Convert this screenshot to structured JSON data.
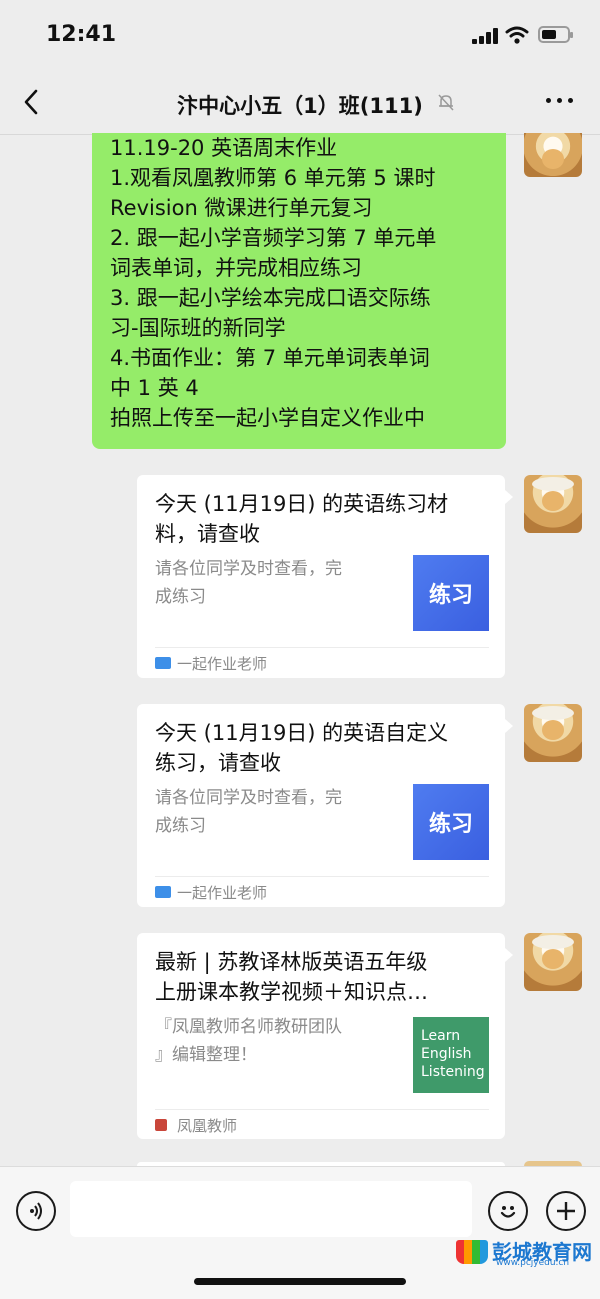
{
  "status_bar": {
    "time": "12:41"
  },
  "chat": {
    "title": "汴中心小五（1）班(111)"
  },
  "messages": {
    "text_bubble_lines": [
      "11.19-20 英语周末作业",
      "1.观看凤凰教师第 6 单元第 5 课时",
      "Revision 微课进行单元复习",
      "2. 跟一起小学音频学习第 7 单元单",
      "词表单词，并完成相应练习",
      "3. 跟一起小学绘本完成口语交际练",
      "习-国际班的新同学",
      "4.书面作业：第 7 单元单词表单词",
      "中 1 英 4",
      "拍照上传至一起小学自定义作业中"
    ],
    "cards": [
      {
        "title_lines": [
          "今天 (11月19日) 的英语练习材",
          "料，请查收"
        ],
        "desc_lines": [
          "请各位同学及时查看，完",
          "成练习"
        ],
        "thumb_text": "练习",
        "source": "一起作业老师"
      },
      {
        "title_lines": [
          "今天 (11月19日) 的英语自定义",
          "练习，请查收"
        ],
        "desc_lines": [
          "请各位同学及时查看，完",
          "成练习"
        ],
        "thumb_text": "练习",
        "source": "一起作业老师"
      },
      {
        "title_lines": [
          "最新 | 苏教译林版英语五年级",
          "上册课本教学视频＋知识点…"
        ],
        "desc_lines": [
          "『凤凰教师名师教研团队",
          "』编辑整理！"
        ],
        "thumb_lines": [
          "Learn",
          "English",
          "Listening"
        ],
        "source": "凤凰教师"
      }
    ]
  },
  "watermark": {
    "name": "彭城教育网",
    "url": "www.pcjyedu.cn"
  },
  "colors": {
    "bubble": "#95ec69",
    "background": "#ededed",
    "practice_thumb": "#3a5fe0",
    "listen_thumb": "#3f9a6a"
  }
}
